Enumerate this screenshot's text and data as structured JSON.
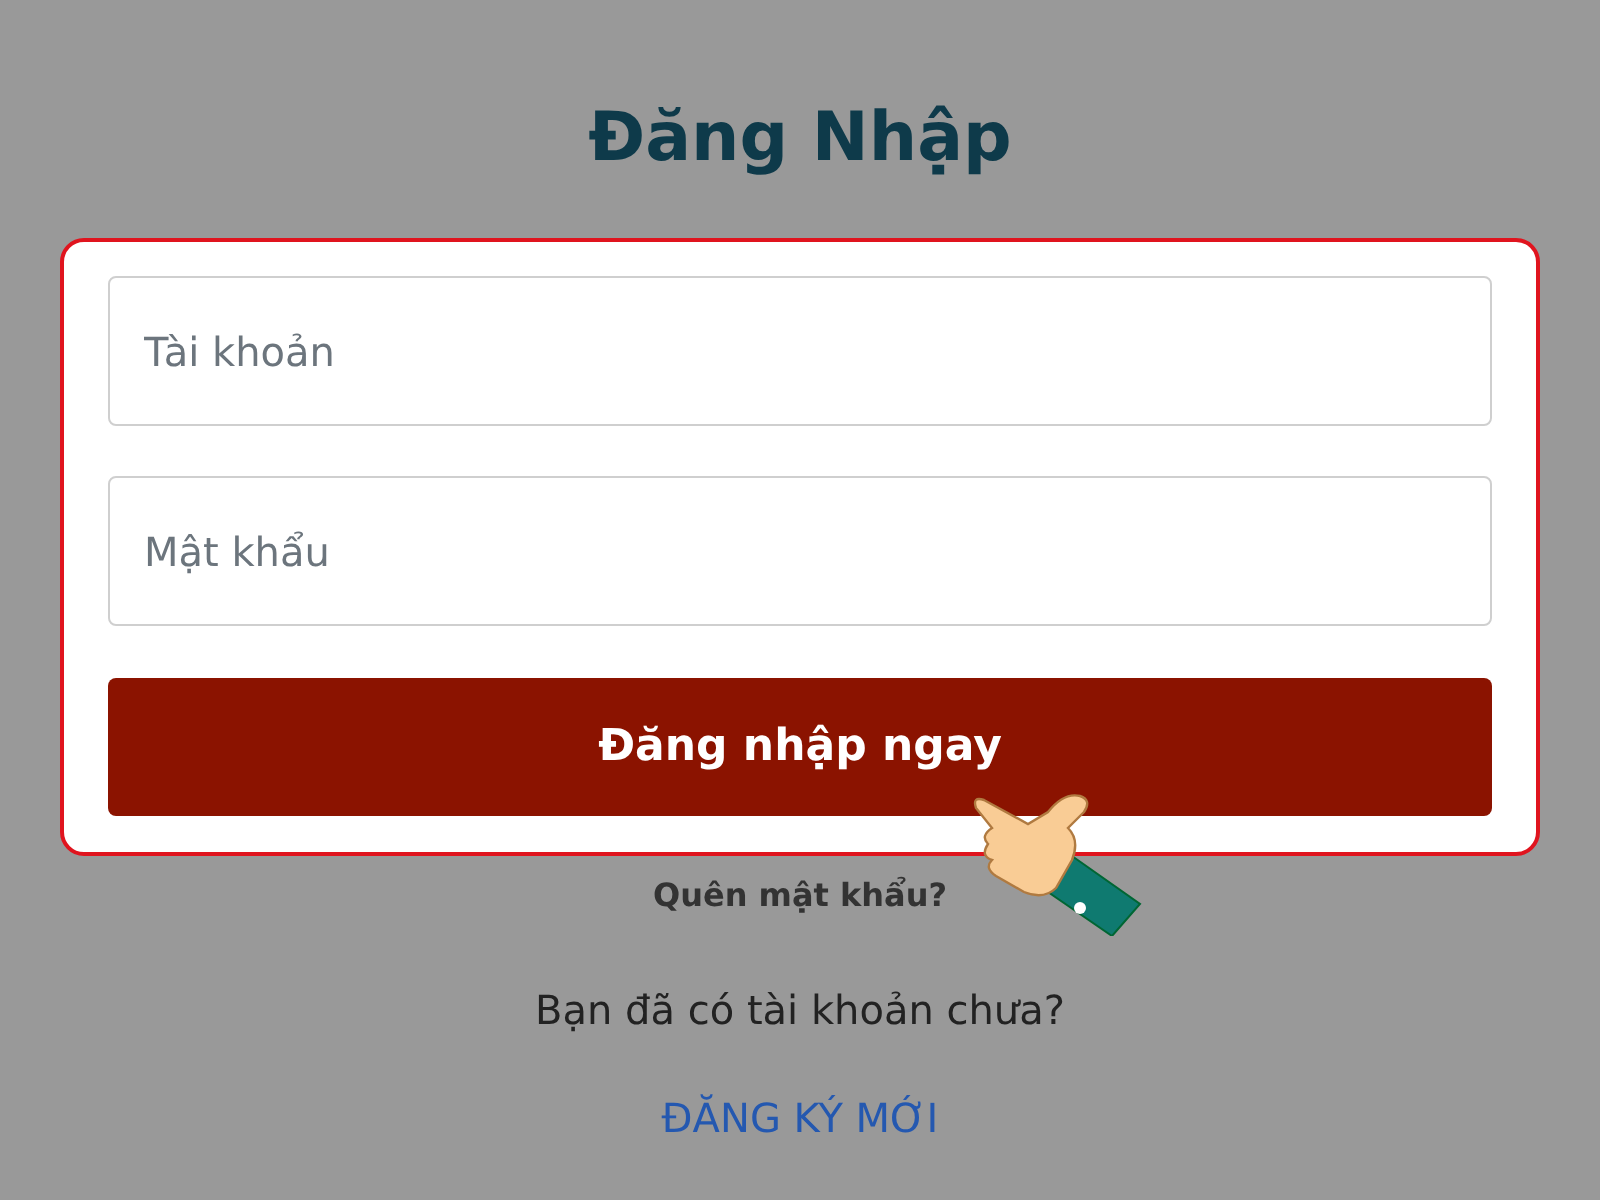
{
  "title": "Đăng Nhập",
  "fields": [
    {
      "placeholder": "Tài khoản"
    },
    {
      "placeholder": "Mật khẩu"
    }
  ],
  "submit": "Đăng nhập ngay",
  "forgot": "Quên mật khẩu?",
  "prompt": "Bạn đã có tài khoản chưa?",
  "register": "ĐĂNG KÝ MỚI"
}
